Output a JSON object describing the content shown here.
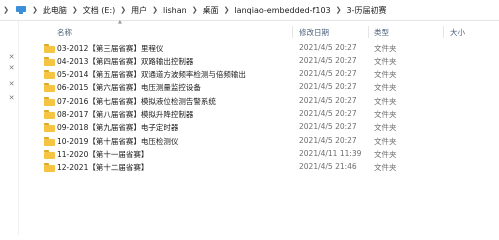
{
  "breadcrumb": {
    "items": [
      "此电脑",
      "文档 (E:)",
      "用户",
      "lishan",
      "桌面",
      "lanqiao-embedded-f103",
      "3-历届初赛"
    ]
  },
  "columns": {
    "name": "名称",
    "date": "修改日期",
    "type": "类型",
    "size": "大小"
  },
  "files": [
    {
      "name": "03-2012【第三届省赛】里程仪",
      "date": "2021/4/5 20:27",
      "type": "文件夹"
    },
    {
      "name": "04-2013【第四届省赛】双路输出控制器",
      "date": "2021/4/5 20:27",
      "type": "文件夹"
    },
    {
      "name": "05-2014【第五届省赛】双通道方波频率检测与倍频输出",
      "date": "2021/4/5 20:27",
      "type": "文件夹"
    },
    {
      "name": "06-2015【第六届省赛】电压测量监控设备",
      "date": "2021/4/5 20:27",
      "type": "文件夹"
    },
    {
      "name": "07-2016【第七届省赛】模拟液位检测告警系统",
      "date": "2021/4/5 20:27",
      "type": "文件夹"
    },
    {
      "name": "08-2017【第八届省赛】模拟升降控制器",
      "date": "2021/4/5 20:27",
      "type": "文件夹"
    },
    {
      "name": "09-2018【第九届省赛】电子定时器",
      "date": "2021/4/5 20:27",
      "type": "文件夹"
    },
    {
      "name": "10-2019【第十届省赛】电压检测仪",
      "date": "2021/4/5 20:27",
      "type": "文件夹"
    },
    {
      "name": "11-2020【第十一届省赛】",
      "date": "2021/4/11 11:39",
      "type": "文件夹"
    },
    {
      "name": "12-2021【第十二届省赛】",
      "date": "2021/4/5 21:46",
      "type": "文件夹"
    }
  ]
}
